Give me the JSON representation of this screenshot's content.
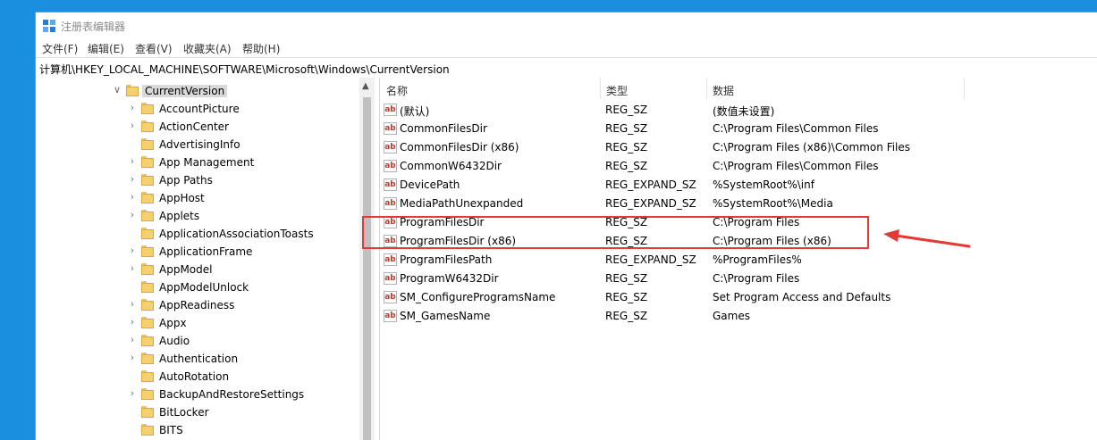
{
  "window": {
    "title": "注册表编辑器"
  },
  "menu": [
    "文件(F)",
    "编辑(E)",
    "查看(V)",
    "收藏夹(A)",
    "帮助(H)"
  ],
  "address": "计算机\\HKEY_LOCAL_MACHINE\\SOFTWARE\\Microsoft\\Windows\\CurrentVersion",
  "tree": {
    "selected": "CurrentVersion",
    "children": [
      {
        "label": "AccountPicture",
        "expandable": true
      },
      {
        "label": "ActionCenter",
        "expandable": true
      },
      {
        "label": "AdvertisingInfo",
        "expandable": false
      },
      {
        "label": "App Management",
        "expandable": true
      },
      {
        "label": "App Paths",
        "expandable": true
      },
      {
        "label": "AppHost",
        "expandable": true
      },
      {
        "label": "Applets",
        "expandable": true
      },
      {
        "label": "ApplicationAssociationToasts",
        "expandable": false
      },
      {
        "label": "ApplicationFrame",
        "expandable": true
      },
      {
        "label": "AppModel",
        "expandable": true
      },
      {
        "label": "AppModelUnlock",
        "expandable": false
      },
      {
        "label": "AppReadiness",
        "expandable": true
      },
      {
        "label": "Appx",
        "expandable": true
      },
      {
        "label": "Audio",
        "expandable": true
      },
      {
        "label": "Authentication",
        "expandable": true
      },
      {
        "label": "AutoRotation",
        "expandable": false
      },
      {
        "label": "BackupAndRestoreSettings",
        "expandable": true
      },
      {
        "label": "BitLocker",
        "expandable": false
      },
      {
        "label": "BITS",
        "expandable": false
      }
    ]
  },
  "columns": {
    "name": "名称",
    "type": "类型",
    "data": "数据"
  },
  "values": [
    {
      "name": "(默认)",
      "type": "REG_SZ",
      "data": "(数值未设置)"
    },
    {
      "name": "CommonFilesDir",
      "type": "REG_SZ",
      "data": "C:\\Program Files\\Common Files"
    },
    {
      "name": "CommonFilesDir (x86)",
      "type": "REG_SZ",
      "data": "C:\\Program Files (x86)\\Common Files"
    },
    {
      "name": "CommonW6432Dir",
      "type": "REG_SZ",
      "data": "C:\\Program Files\\Common Files"
    },
    {
      "name": "DevicePath",
      "type": "REG_EXPAND_SZ",
      "data": "%SystemRoot%\\inf"
    },
    {
      "name": "MediaPathUnexpanded",
      "type": "REG_EXPAND_SZ",
      "data": "%SystemRoot%\\Media"
    },
    {
      "name": "ProgramFilesDir",
      "type": "REG_SZ",
      "data": "C:\\Program Files"
    },
    {
      "name": "ProgramFilesDir (x86)",
      "type": "REG_SZ",
      "data": "C:\\Program Files (x86)"
    },
    {
      "name": "ProgramFilesPath",
      "type": "REG_EXPAND_SZ",
      "data": "%ProgramFiles%"
    },
    {
      "name": "ProgramW6432Dir",
      "type": "REG_SZ",
      "data": "C:\\Program Files"
    },
    {
      "name": "SM_ConfigureProgramsName",
      "type": "REG_SZ",
      "data": "Set Program Access and Defaults"
    },
    {
      "name": "SM_GamesName",
      "type": "REG_SZ",
      "data": "Games"
    }
  ],
  "value_icon": "ab",
  "colors": {
    "annotation": "#e53935",
    "desktop": "#1a8fe0",
    "folder": "#f4d06f"
  }
}
